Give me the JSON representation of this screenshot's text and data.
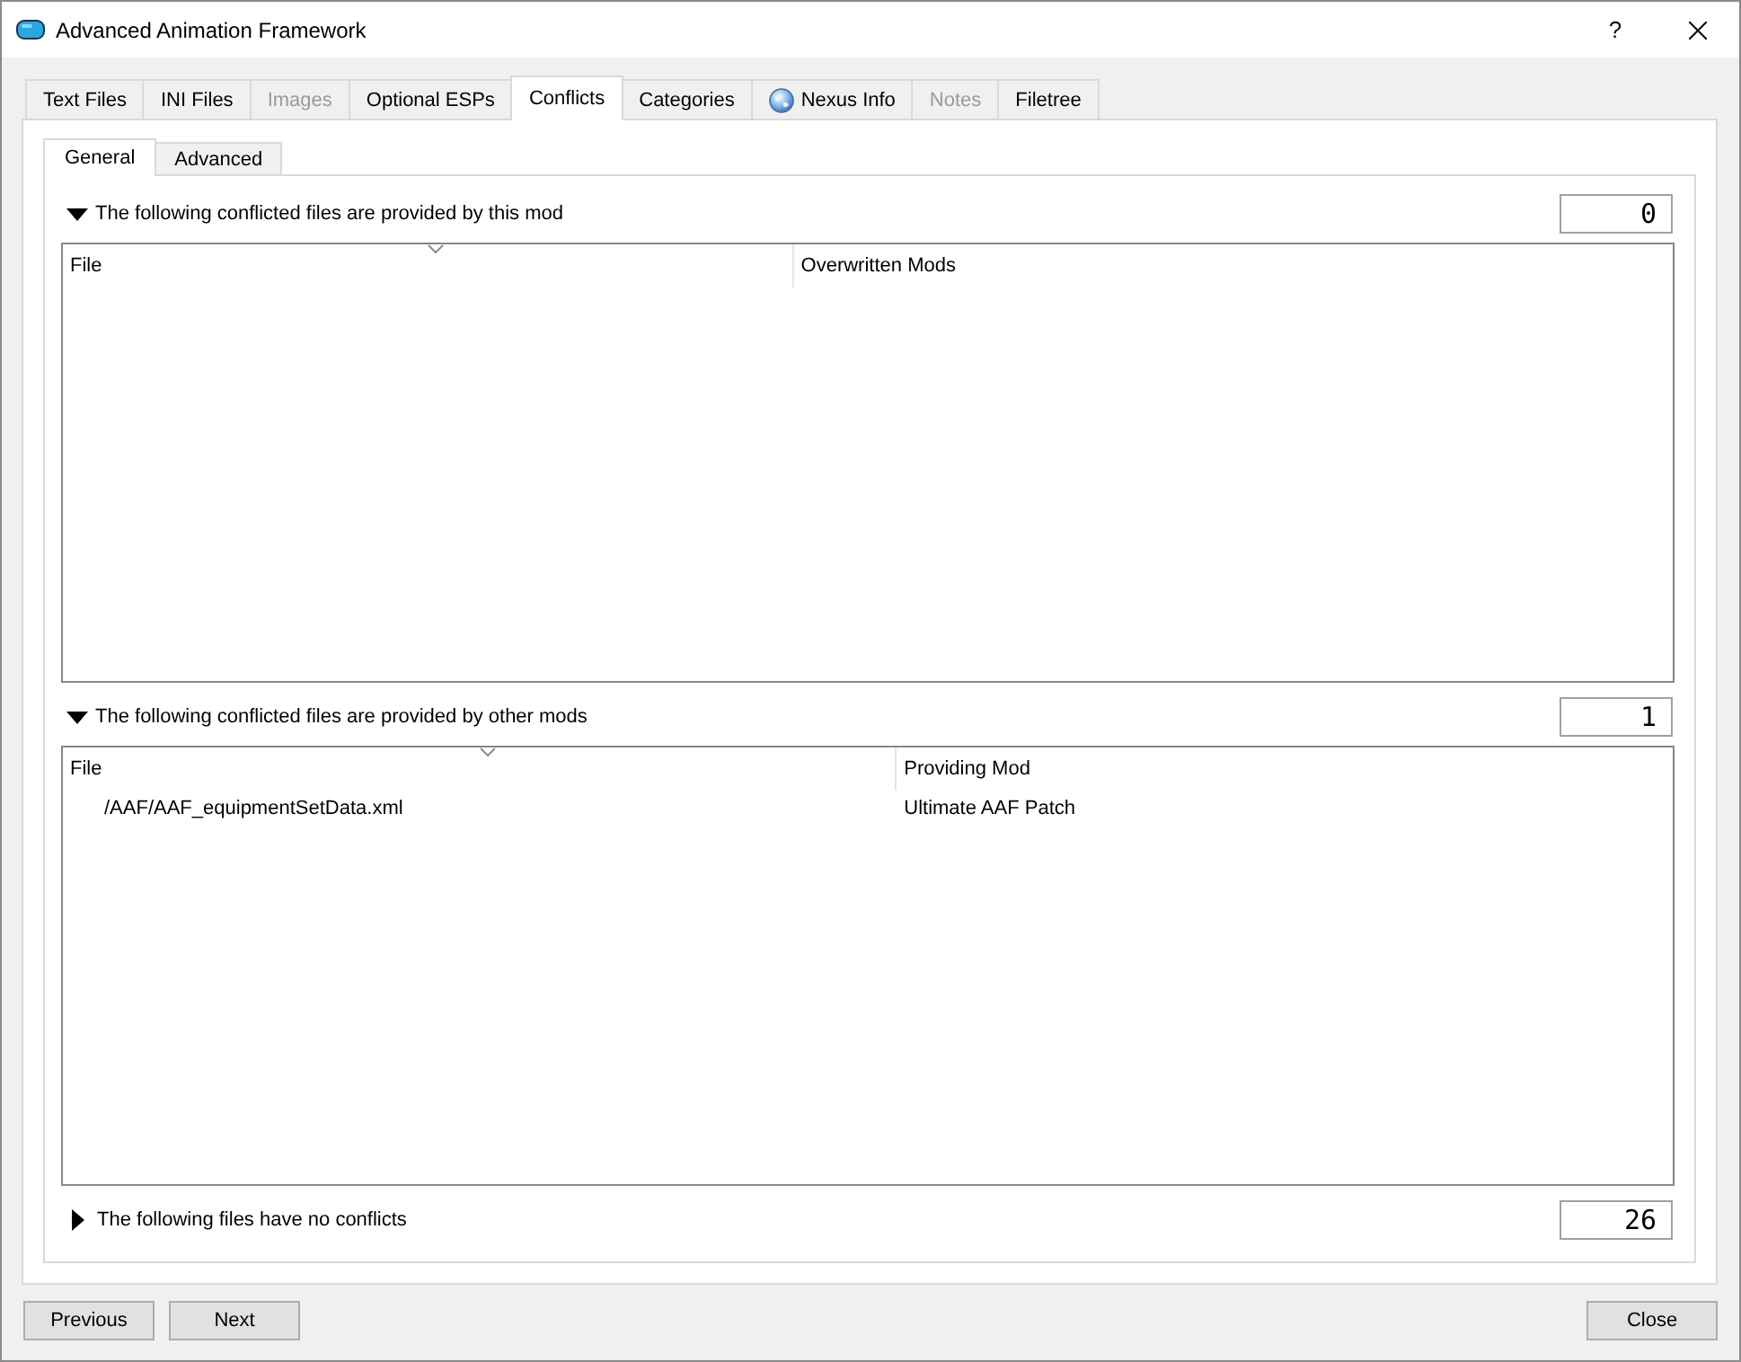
{
  "window": {
    "title": "Advanced Animation Framework",
    "help": "?"
  },
  "tabs": [
    {
      "label": "Text Files",
      "kind": "plain",
      "selected": false,
      "disabled": false
    },
    {
      "label": "INI Files",
      "kind": "plain",
      "selected": false,
      "disabled": false
    },
    {
      "label": "Images",
      "kind": "plain",
      "selected": false,
      "disabled": true
    },
    {
      "label": "Optional ESPs",
      "kind": "plain",
      "selected": false,
      "disabled": false
    },
    {
      "label": "Conflicts",
      "kind": "plain",
      "selected": true,
      "disabled": false
    },
    {
      "label": "Categories",
      "kind": "plain",
      "selected": false,
      "disabled": false
    },
    {
      "label": "Nexus Info",
      "kind": "icon",
      "selected": false,
      "disabled": false
    },
    {
      "label": "Notes",
      "kind": "plain",
      "selected": false,
      "disabled": true
    },
    {
      "label": "Filetree",
      "kind": "plain",
      "selected": false,
      "disabled": false
    }
  ],
  "subtabs": [
    {
      "label": "General",
      "selected": true
    },
    {
      "label": "Advanced",
      "selected": false
    }
  ],
  "sections": [
    {
      "title": "The following conflicted files are provided by this mod",
      "expanded": true,
      "count": "0",
      "columns": [
        {
          "label": "File",
          "sorted": true
        },
        {
          "label": "Overwritten Mods",
          "sorted": false
        }
      ]
    },
    {
      "title": "The following conflicted files are provided by other mods",
      "expanded": true,
      "count": "1",
      "columns": [
        {
          "label": "File",
          "sorted": true
        },
        {
          "label": "Providing Mod",
          "sorted": false
        }
      ],
      "rows": [
        [
          "/AAF/AAF_equipmentSetData.xml",
          "Ultimate AAF Patch"
        ]
      ]
    },
    {
      "title": "The following files have no conflicts",
      "expanded": false,
      "count": "26"
    }
  ],
  "footer": {
    "navigation": [
      "Previous",
      "Next"
    ],
    "close": "Close"
  }
}
